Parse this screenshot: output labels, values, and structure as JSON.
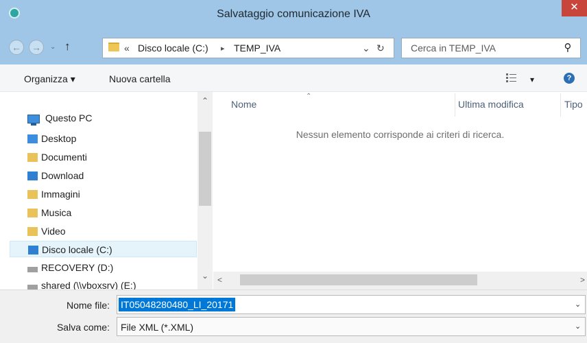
{
  "window": {
    "title": "Salvataggio comunicazione IVA",
    "close": "✕"
  },
  "address": {
    "overflow": "«",
    "path": [
      "Disco locale (C:)",
      "TEMP_IVA"
    ],
    "separator": "▸",
    "dropdown": "⌄",
    "refresh": "↻"
  },
  "search": {
    "placeholder": "Cerca in TEMP_IVA",
    "icon": "⚲"
  },
  "nav_buttons": {
    "back": "←",
    "forward": "→",
    "history": "⌄",
    "up": "↑"
  },
  "toolbar": {
    "organize": "Organizza ▾",
    "new_folder": "Nuova cartella",
    "view_menu": "▾",
    "help": "?"
  },
  "sidebar": {
    "header": "Questo PC",
    "items": [
      {
        "label": "Desktop",
        "icon": "desktop-folder-icon",
        "color": "#3b8de0"
      },
      {
        "label": "Documenti",
        "icon": "documents-folder-icon",
        "color": "#e9c35a"
      },
      {
        "label": "Download",
        "icon": "download-folder-icon",
        "color": "#2f7fd3"
      },
      {
        "label": "Immagini",
        "icon": "pictures-folder-icon",
        "color": "#e9c35a"
      },
      {
        "label": "Musica",
        "icon": "music-folder-icon",
        "color": "#e9c35a"
      },
      {
        "label": "Video",
        "icon": "video-folder-icon",
        "color": "#e9c35a"
      },
      {
        "label": "Disco locale (C:)",
        "icon": "windows-drive-icon",
        "color": "#2f7fd3",
        "selected": true
      },
      {
        "label": "RECOVERY (D:)",
        "icon": "drive-icon",
        "color": "#a0a0a0"
      },
      {
        "label": "shared (\\\\vboxsrv) (E:)",
        "icon": "network-drive-icon",
        "color": "#a0a0a0"
      }
    ],
    "scroll_up": "⌃",
    "scroll_down": "⌄"
  },
  "columns": [
    {
      "label": "Nome",
      "sorted": true
    },
    {
      "label": "Ultima modifica"
    },
    {
      "label": "Tipo"
    }
  ],
  "sort_indicator": "⌃",
  "empty_message": "Nessun elemento corrisponde ai criteri di ricerca.",
  "hscroll": {
    "left": "<",
    "right": ">"
  },
  "form": {
    "filename_label": "Nome file:",
    "filename_value": "IT05048280480_LI_20171",
    "savetype_label": "Salva come:",
    "savetype_value": "File XML (*.XML)",
    "dropdown": "⌄"
  },
  "colors": {
    "titlebar": "#9fc6e6",
    "selection": "#0078d7",
    "selected_item": "#e5f3fb"
  }
}
